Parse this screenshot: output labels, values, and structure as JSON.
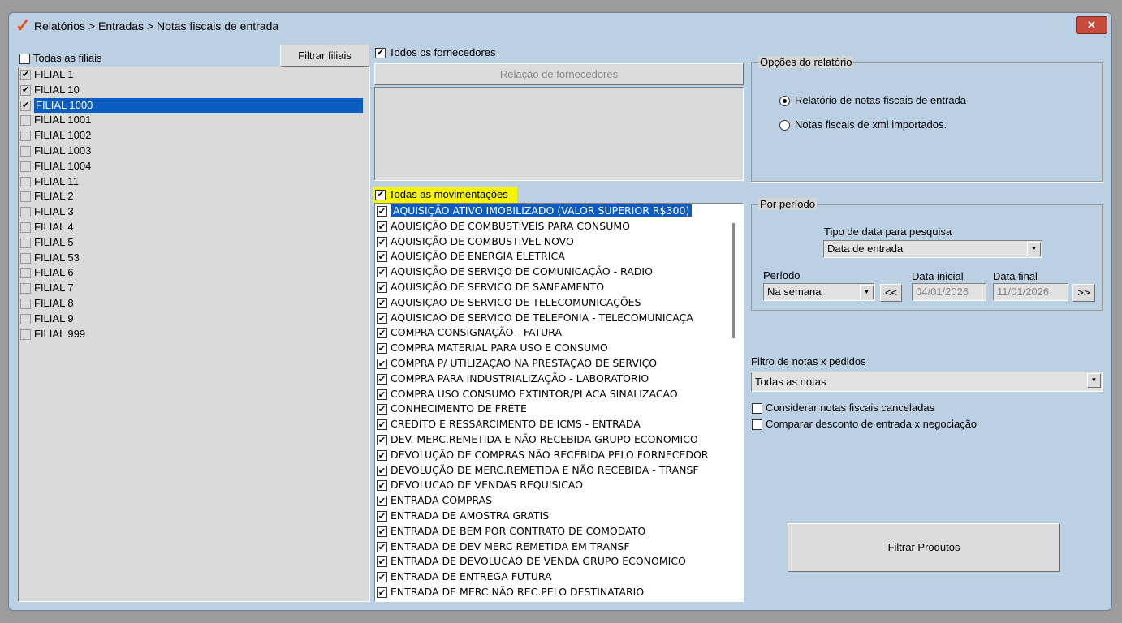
{
  "window": {
    "title": "Relatórios > Entradas > Notas fiscais de entrada",
    "close": "✕"
  },
  "filiais": {
    "all_label": "Todas as filiais",
    "all_checked": false,
    "filter_button": "Filtrar filiais",
    "items": [
      {
        "label": "FILIAL 1",
        "checked": true
      },
      {
        "label": "FILIAL 10",
        "checked": true
      },
      {
        "label": "FILIAL 1000",
        "checked": true,
        "selected": true
      },
      {
        "label": "FILIAL 1001",
        "checked": false
      },
      {
        "label": "FILIAL 1002",
        "checked": false
      },
      {
        "label": "FILIAL 1003",
        "checked": false
      },
      {
        "label": "FILIAL 1004",
        "checked": false
      },
      {
        "label": "FILIAL 11",
        "checked": false
      },
      {
        "label": "FILIAL 2",
        "checked": false
      },
      {
        "label": "FILIAL 3",
        "checked": false
      },
      {
        "label": "FILIAL 4",
        "checked": false
      },
      {
        "label": "FILIAL 5",
        "checked": false
      },
      {
        "label": "FILIAL 53",
        "checked": false
      },
      {
        "label": "FILIAL 6",
        "checked": false
      },
      {
        "label": "FILIAL 7",
        "checked": false
      },
      {
        "label": "FILIAL 8",
        "checked": false
      },
      {
        "label": "FILIAL 9",
        "checked": false
      },
      {
        "label": "FILIAL 999",
        "checked": false
      }
    ]
  },
  "fornecedores": {
    "all_label": "Todos os fornecedores",
    "all_checked": true,
    "relation_button": "Relação de fornecedores"
  },
  "movimentacoes": {
    "all_label": "Todas as movimentações",
    "all_checked": true,
    "highlight": "#f5f500",
    "items": [
      "AQUISIÇÃO ATIVO IMOBILIZADO (VALOR SUPERIOR R$300)",
      "AQUISIÇÃO DE COMBUSTÍVEIS PARA CONSUMO",
      "AQUISIÇÃO DE COMBUSTIVEL NOVO",
      "AQUISIÇÃO DE ENERGIA ELETRICA",
      "AQUISIÇÃO DE SERVIÇO DE COMUNICAÇÃO - RADIO",
      "AQUISIÇÃO DE SERVICO DE SANEAMENTO",
      "AQUISIÇAO DE SERVICO DE TELECOMUNICAÇÕES",
      "AQUISICAO DE SERVICO DE TELEFONIA - TELECOMUNICAÇA",
      "COMPRA CONSIGNAÇÃO - FATURA",
      "COMPRA MATERIAL PARA USO E CONSUMO",
      "COMPRA P/ UTILIZAÇAO NA PRESTAÇAO DE SERVIÇO",
      "COMPRA PARA INDUSTRIALIZAÇÃO - LABORATORIO",
      "COMPRA USO CONSUMO EXTINTOR/PLACA SINALIZACAO",
      "CONHECIMENTO DE FRETE",
      "CREDITO E RESSARCIMENTO DE ICMS - ENTRADA",
      "DEV. MERC.REMETIDA E NÃO RECEBIDA GRUPO ECONOMICO",
      "DEVOLUÇÃO DE COMPRAS NÃO RECEBIDA PELO FORNECEDOR",
      "DEVOLUÇÃO DE MERC.REMETIDA E NÃO RECEBIDA - TRANSF",
      "DEVOLUCAO DE VENDAS REQUISICAO",
      "ENTRADA COMPRAS",
      "ENTRADA DE AMOSTRA GRATIS",
      "ENTRADA DE BEM POR CONTRATO DE COMODATO",
      "ENTRADA DE DEV MERC REMETIDA EM TRANSF",
      "ENTRADA DE DEVOLUCAO DE VENDA GRUPO ECONOMICO",
      "ENTRADA DE ENTREGA FUTURA",
      "ENTRADA DE MERC.NÃO REC.PELO DESTINATARIO"
    ]
  },
  "opcoes": {
    "title": "Opções do relatório",
    "radio1": "Relatório de notas fiscais de entrada",
    "radio2": "Notas fiscais de xml importados.",
    "selected": 1
  },
  "periodo": {
    "title": "Por período",
    "tipo_label": "Tipo de data para pesquisa",
    "tipo_value": "Data de entrada",
    "periodo_label": "Período",
    "periodo_value": "Na semana",
    "prev": "<<",
    "next": ">>",
    "inicial_label": "Data inicial",
    "inicial_value": "04/01/2026",
    "final_label": "Data final",
    "final_value": "11/01/2026"
  },
  "filtro": {
    "label": "Filtro de notas x pedidos",
    "value": "Todas as notas",
    "chk1": "Considerar notas fiscais canceladas",
    "chk2": "Comparar desconto de entrada x negociação"
  },
  "filtrar_produtos": "Filtrar Produtos"
}
